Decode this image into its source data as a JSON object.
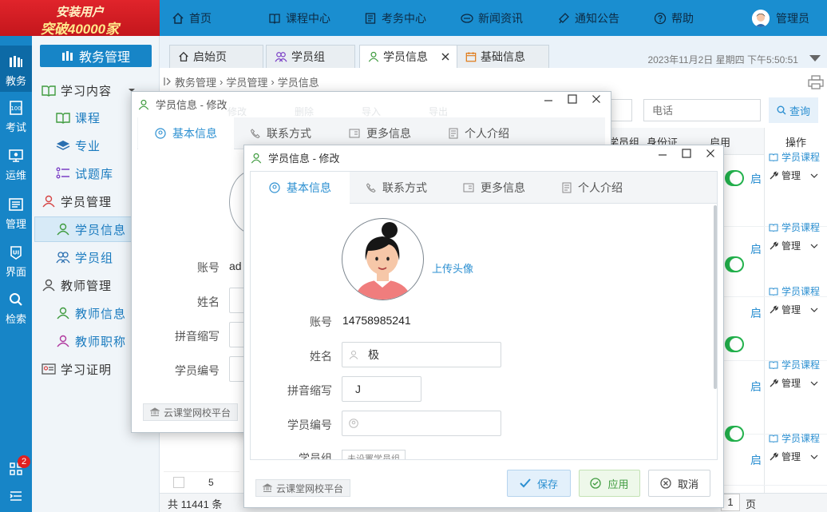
{
  "promo": {
    "line1": "安装用户",
    "line2": "突破40000家"
  },
  "top_nav": [
    {
      "label": "首页",
      "icon": "home-icon"
    },
    {
      "label": "课程中心",
      "icon": "book-icon"
    },
    {
      "label": "考务中心",
      "icon": "exam-icon"
    },
    {
      "label": "新闻资讯",
      "icon": "news-icon"
    },
    {
      "label": "通知公告",
      "icon": "notice-icon"
    },
    {
      "label": "帮助",
      "icon": "help-icon"
    }
  ],
  "user": {
    "name": "管理员"
  },
  "rail": [
    {
      "label": "教务",
      "icon": "edu-icon"
    },
    {
      "label": "考试",
      "icon": "exam-icon"
    },
    {
      "label": "运维",
      "icon": "ops-icon"
    },
    {
      "label": "管理",
      "icon": "manage-icon"
    },
    {
      "label": "界面",
      "icon": "ui-icon"
    },
    {
      "label": "检索",
      "icon": "search-icon"
    }
  ],
  "rail_badge": "2",
  "menu": {
    "title": "教务管理",
    "items": [
      {
        "label": "学习内容",
        "icon": "book-open-icon",
        "level": "group"
      },
      {
        "label": "课程",
        "icon": "course-icon",
        "level": "sub"
      },
      {
        "label": "专业",
        "icon": "layers-icon",
        "level": "sub"
      },
      {
        "label": "试题库",
        "icon": "question-bank-icon",
        "level": "sub"
      },
      {
        "label": "学员管理",
        "icon": "student-manage-icon",
        "level": "group"
      },
      {
        "label": "学员信息",
        "icon": "student-icon",
        "level": "active"
      },
      {
        "label": "学员组",
        "icon": "group-icon",
        "level": "sub"
      },
      {
        "label": "教师管理",
        "icon": "teacher-icon",
        "level": "group"
      },
      {
        "label": "教师信息",
        "icon": "teacher-info-icon",
        "level": "sub"
      },
      {
        "label": "教师职称",
        "icon": "teacher-title-icon",
        "level": "sub"
      },
      {
        "label": "学习证明",
        "icon": "certificate-icon",
        "level": "group"
      }
    ]
  },
  "tabs": [
    {
      "label": "启始页",
      "icon": "home-icon"
    },
    {
      "label": "学员组",
      "icon": "group-icon"
    },
    {
      "label": "学员信息",
      "icon": "student-icon",
      "active": true
    },
    {
      "label": "基础信息",
      "icon": "calendar-icon"
    }
  ],
  "datetime": "2023年11月2日 星期四 下午5:50:51",
  "breadcrumb": [
    "教务管理",
    "学员管理",
    "学员信息"
  ],
  "toolbar": {
    "phone_placeholder": "电话",
    "query": "查询"
  },
  "table": {
    "headers": {
      "group": "学员组",
      "id_card": "身份证",
      "enable": "启用",
      "ops": "操作"
    },
    "rows": [
      {
        "enable": "启",
        "course": "学员课程",
        "manage": "管理"
      },
      {
        "enable": "启",
        "course": "学员课程",
        "manage": "管理"
      },
      {
        "enable": "启",
        "course": "学员课程",
        "manage": "管理"
      },
      {
        "enable": "启",
        "course": "学员课程",
        "manage": "管理"
      },
      {
        "enable": "启",
        "course": "学员课程",
        "manage": "管理"
      }
    ],
    "row5_index": "5",
    "footer_total": "共 11441 条",
    "footer_page": "1",
    "footer_page_unit": "页"
  },
  "back_dialog": {
    "title": "学员信息 - 修改",
    "tabs": [
      "基本信息",
      "联系方式",
      "更多信息",
      "个人介绍"
    ],
    "labels": [
      "账号",
      "姓名",
      "拼音缩写",
      "学员编号"
    ],
    "account_partial": "ad",
    "platform": "云课堂网校平台",
    "toolbar_hidden": [
      "修改",
      "删除",
      "导入",
      "导出"
    ]
  },
  "dialog": {
    "title": "学员信息 - 修改",
    "tabs": [
      "基本信息",
      "联系方式",
      "更多信息",
      "个人介绍"
    ],
    "upload": "上传头像",
    "fields": {
      "account_label": "账号",
      "account_value": "14758985241",
      "name_label": "姓名",
      "name_value": "极",
      "pinyin_label": "拼音缩写",
      "pinyin_value": "J",
      "number_label": "学员编号",
      "number_value": "",
      "group_label": "学员组",
      "group_value": "未设置学员组"
    },
    "platform": "云课堂网校平台",
    "buttons": {
      "save": "保存",
      "apply": "应用",
      "cancel": "取消"
    }
  },
  "colors": {
    "primary": "#1785c7",
    "accent": "#2b8fd1",
    "toggle": "#22b14c",
    "promo": "#d41d24"
  }
}
